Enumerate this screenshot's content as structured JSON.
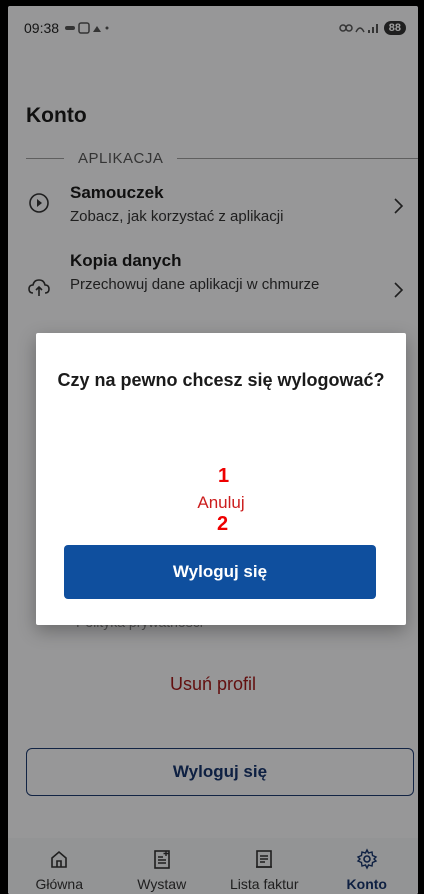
{
  "status_bar": {
    "time": "09:38",
    "battery": "88"
  },
  "page": {
    "title": "Konto"
  },
  "section": {
    "label": "APLIKACJA"
  },
  "items": [
    {
      "title": "Samouczek",
      "subtitle": "Zobacz, jak korzystać z aplikacji",
      "icon": "play-circle-icon"
    },
    {
      "title": "Kopia danych",
      "subtitle": "Przechowuj dane aplikacji w chmurze",
      "icon": "cloud-upload-icon"
    }
  ],
  "hidden_row_text": "Polityka prywatności",
  "delete_profile_label": "Usuń profil",
  "logout_button_label": "Wyloguj się",
  "nav": [
    {
      "label": "Główna",
      "icon": "home-icon"
    },
    {
      "label": "Wystaw",
      "icon": "document-add-icon"
    },
    {
      "label": "Lista faktur",
      "icon": "invoice-list-icon"
    },
    {
      "label": "Konto",
      "icon": "gear-icon",
      "active": true
    }
  ],
  "dialog": {
    "question": "Czy na pewno chcesz się wylogować?",
    "cancel_label": "Anuluj",
    "confirm_label": "Wyloguj się",
    "marker_1": "1",
    "marker_2": "2"
  },
  "colors": {
    "primary": "#0f4f9e",
    "danger": "#cc1e1e",
    "accent_dark": "#17356b"
  }
}
